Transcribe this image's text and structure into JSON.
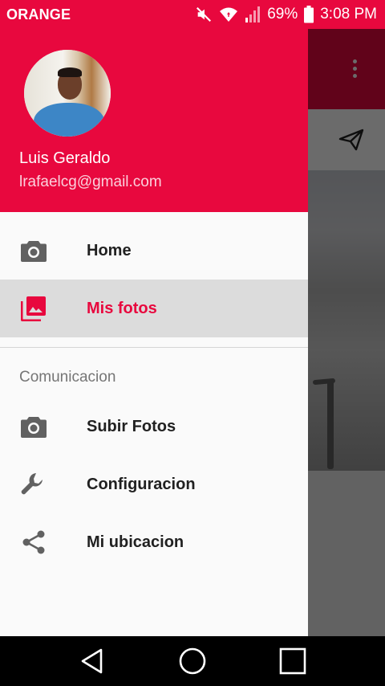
{
  "status_bar": {
    "carrier": "ORANGE",
    "battery": "69%",
    "time": "3:08 PM",
    "icons": [
      "mute-icon",
      "wifi-icon",
      "signal-icon",
      "battery-icon"
    ]
  },
  "drawer": {
    "header": {
      "name": "Luis Geraldo",
      "email": "lrafaelcg@gmail.com"
    },
    "items": [
      {
        "label": "Home",
        "icon": "camera-icon",
        "selected": false
      },
      {
        "label": "Mis fotos",
        "icon": "photo-library-icon",
        "selected": true
      }
    ],
    "section_title": "Comunicacion",
    "section_items": [
      {
        "label": "Subir Fotos",
        "icon": "camera-icon"
      },
      {
        "label": "Configuracion",
        "icon": "wrench-icon"
      },
      {
        "label": "Mi ubicacion",
        "icon": "share-icon"
      }
    ]
  },
  "colors": {
    "accent": "#e8083e",
    "selected_bg": "#dcdcdc",
    "icon_gray": "#616161"
  },
  "nav_bar": {
    "icons": [
      "back-icon",
      "home-icon",
      "recents-icon"
    ]
  }
}
